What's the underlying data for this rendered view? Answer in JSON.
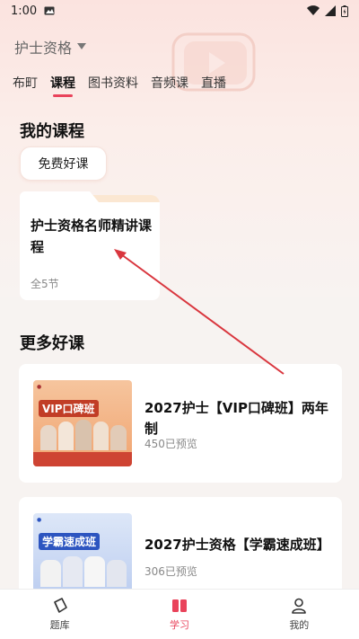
{
  "status": {
    "time": "1:00"
  },
  "header": {
    "title": "护士资格"
  },
  "tabs": [
    {
      "label": "布町"
    },
    {
      "label": "课程"
    },
    {
      "label": "图书资料"
    },
    {
      "label": "音频课"
    },
    {
      "label": "直播"
    }
  ],
  "my_courses": {
    "title": "我的课程",
    "chip": "免费好课",
    "folder": {
      "title": "护士资格名师精讲课程",
      "count": "全5节"
    }
  },
  "more": {
    "title": "更多好课",
    "courses": [
      {
        "title": "2027护士【VIP口碑班】两年制",
        "meta": "450已预览",
        "banner": "VIP口碑班"
      },
      {
        "title": "2027护士资格【学霸速成班】",
        "meta": "306已预览",
        "banner": "学霸速成班"
      }
    ]
  },
  "nav": [
    {
      "label": "题库"
    },
    {
      "label": "学习"
    },
    {
      "label": "我的"
    }
  ],
  "colors": {
    "accent": "#e9435b",
    "annotation": "#d9363e"
  }
}
